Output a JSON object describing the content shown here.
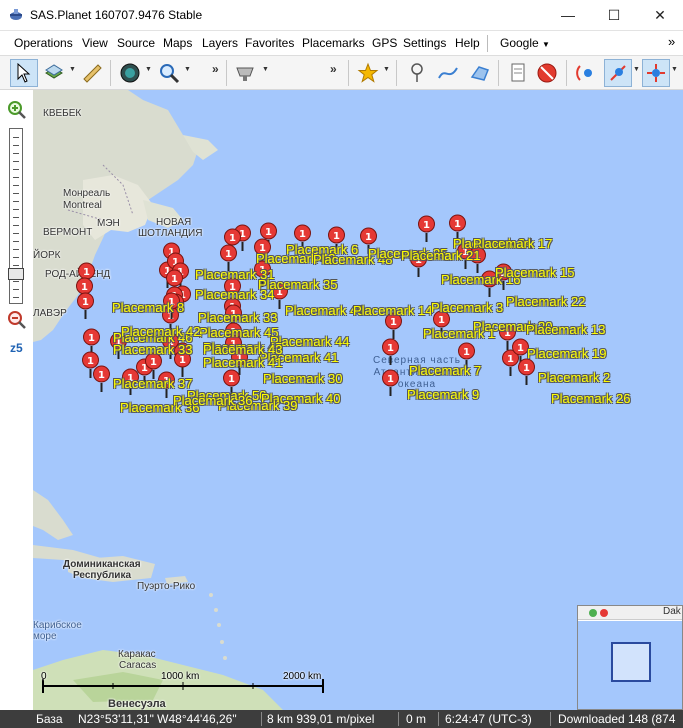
{
  "window": {
    "title": "SAS.Planet 160707.9476 Stable",
    "minimize_glyph": "—",
    "maximize_glyph": "☐",
    "close_glyph": "✕"
  },
  "menu": {
    "items": [
      {
        "label": "Operations"
      },
      {
        "label": "View"
      },
      {
        "label": "Source"
      },
      {
        "label": "Maps"
      },
      {
        "label": "Layers"
      },
      {
        "label": "Favorites"
      },
      {
        "label": "Placemarks"
      },
      {
        "label": "GPS"
      },
      {
        "label": "Settings"
      },
      {
        "label": "Help"
      }
    ],
    "search_engine": "Google",
    "overflow": "»"
  },
  "toolbar": {
    "overflow": "»",
    "icons": [
      "cursor-icon",
      "map-layers-icon",
      "ruler-icon",
      "compass-globe-icon",
      "zoom-magnifier-icon",
      "satellite-dish-icon",
      "star-icon",
      "placemark-pin-icon",
      "path-icon",
      "polygon-icon",
      "placemark-list-icon",
      "no-entry-icon",
      "gps-signal-icon",
      "gps-track-icon",
      "gps-center-icon"
    ]
  },
  "zoom": {
    "level_label": "z5",
    "level_fraction": 0.79
  },
  "map": {
    "labels": [
      {
        "text": "КВЕБЕК"
      },
      {
        "text": "Монреаль"
      },
      {
        "text": "Montreal"
      },
      {
        "text": "МЭН"
      },
      {
        "text": "НОВАЯ"
      },
      {
        "text": "ВЕРМОНТ"
      },
      {
        "text": "ШОТЛАНДИЯ"
      },
      {
        "text": "ЙОРК"
      },
      {
        "text": "РОД-АЙЛЕНД"
      },
      {
        "text": "ЛАВЭР"
      },
      {
        "text": "Доминиканская"
      },
      {
        "text": "Республика"
      },
      {
        "text": "Пуэрто-Рико"
      },
      {
        "text": "Каракас"
      },
      {
        "text": "Caracas"
      },
      {
        "text": "Венесуэла"
      },
      {
        "text": "Карибское"
      },
      {
        "text": "море"
      }
    ],
    "ocean_label": [
      "Северная часть",
      "Атлантического",
      "океана"
    ],
    "pin_number": "1",
    "placemarks": [
      "Placemark 6",
      "Placemark 43",
      "Placemark 48",
      "Placemark 25",
      "Placemark 21",
      "Placemark 24",
      "Placemark 17",
      "Placemark 31",
      "Placemark 16",
      "Placemark 15",
      "Placemark 35",
      "Placemark 34",
      "Placemark 22",
      "Placemark 8",
      "Placemark 49",
      "Placemark 14",
      "Placemark 33",
      "Placemark 3",
      "Placemark 20",
      "Placemark 13",
      "Placemark 45",
      "Placemark 1",
      "Placemark 44",
      "Placemark 46",
      "Placemark 19",
      "Placemark 41",
      "Placemark 7",
      "Placemark 2",
      "Placemark 37",
      "Placemark 30",
      "Placemark 50",
      "Placemark 9",
      "Placemark 40",
      "Placemark 36",
      "Placemark 26",
      "Placemark 39",
      "Placemark 42"
    ],
    "scale": {
      "zero": "0",
      "mid": "1000 km",
      "max": "2000 km"
    }
  },
  "minimap": {
    "label": "Dak"
  },
  "statusbar": {
    "base_label": "База",
    "coords": "N23°53'11,31\" W48°44'46,26\"",
    "resolution": "8 km 939,01 m/pixel",
    "elevation": "0 m",
    "time": "6:24:47 (UTC-3)",
    "downloaded": "Downloaded 148 (874"
  }
}
